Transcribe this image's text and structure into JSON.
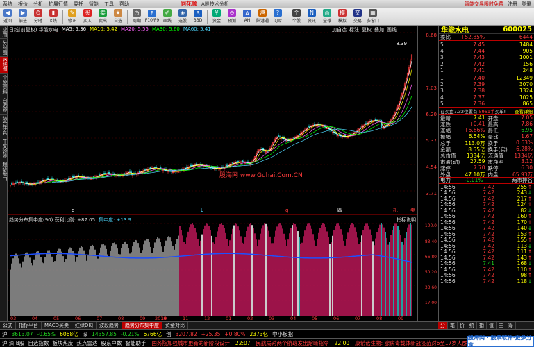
{
  "menubar": {
    "items": [
      "系统",
      "报价",
      "分析",
      "扩展行情",
      "委托",
      "智能",
      "工具",
      "帮助"
    ],
    "brand": "同花顺",
    "subtitle": "A股技术分析",
    "right": [
      "智能交易限时免费",
      "注册",
      "登录"
    ]
  },
  "toolbar": {
    "buttons": [
      {
        "label": "返回",
        "icon": "back-icon"
      },
      {
        "label": "前进",
        "icon": "forward-icon"
      },
      {
        "label": "分时",
        "icon": "timeshare-icon"
      },
      {
        "label": "K线",
        "icon": "kline-icon"
      },
      {
        "label": "修正",
        "icon": "edit-icon"
      },
      {
        "label": "买入",
        "icon": "buy-icon"
      },
      {
        "label": "卖出",
        "icon": "sell-icon"
      },
      {
        "label": "自选",
        "icon": "favorite-icon"
      },
      {
        "label": "周期",
        "icon": "period-icon"
      },
      {
        "label": "F10/F9",
        "icon": "f10-icon"
      },
      {
        "label": "画线",
        "icon": "draw-icon"
      },
      {
        "label": "选股",
        "icon": "screen-icon"
      },
      {
        "label": "BBD",
        "icon": "bbd-icon"
      },
      {
        "label": "资金",
        "icon": "fund-icon"
      },
      {
        "label": "预测",
        "icon": "forecast-icon"
      },
      {
        "label": "AH",
        "icon": "ah-icon"
      },
      {
        "label": "陆港通",
        "icon": "hk-icon"
      },
      {
        "label": "问财",
        "icon": "wencai-icon"
      },
      {
        "label": "个股",
        "icon": "stock-icon"
      },
      {
        "label": "资讯",
        "icon": "news-icon"
      },
      {
        "label": "全球",
        "icon": "global-icon"
      },
      {
        "label": "模拟",
        "icon": "sim-icon"
      },
      {
        "label": "交易",
        "icon": "trade-icon"
      },
      {
        "label": "多窗口",
        "icon": "windows-icon"
      }
    ]
  },
  "lefttabs": [
    "应用",
    "分时图",
    "K线图",
    "个股资料",
    "自选股",
    "综合排名",
    "牛叉诊股",
    "超级盘口"
  ],
  "chart": {
    "header": "日线(前复权)  华能水电",
    "ma": [
      {
        "label": "MA5: 5.36",
        "color": "#ffffff"
      },
      {
        "label": "MA10: 5.42",
        "color": "#ffff00"
      },
      {
        "label": "MA20: 5.55",
        "color": "#ff66ff"
      },
      {
        "label": "MA30: 5.60",
        "color": "#00ff00"
      },
      {
        "label": "MA60: 5.41",
        "color": "#4fd9ff"
      }
    ],
    "header_right": [
      "加自选",
      "标注",
      "复权",
      "叠加",
      "画线"
    ],
    "price_ticks": [
      "8.68",
      "7.03",
      "6.20",
      "5.37",
      "4.54",
      "3.71"
    ],
    "peak_label": "8.39",
    "indicator_header": "趋势分布集中度(90)  获利比例: +87.05",
    "indicator_sub": "集中度: +13.9",
    "indicator_right": "指标说明",
    "ind_ticks": [
      "100.0",
      "83.40",
      "66.80",
      "50.20",
      "33.60",
      "17.00"
    ],
    "dates": [
      "03",
      "04",
      "05",
      "06",
      "07",
      "08",
      "09",
      "10",
      "11",
      "12",
      "01",
      "02",
      "03",
      "04",
      "05",
      "06",
      "07",
      "08",
      "09"
    ],
    "year_label": "2019",
    "watermark_text": "股海网 www.Guhai.Com.CN",
    "markers": [
      "q",
      "L",
      "q",
      "四",
      "机",
      "卖"
    ]
  },
  "chart_data": {
    "type": "candlestick",
    "title": "华能水电 600025",
    "xlabel": "",
    "ylabel": "",
    "ylim": [
      3.71,
      8.68
    ],
    "indicator_ylim": [
      0,
      100
    ]
  },
  "right": {
    "name": "华能水电",
    "code": "600025",
    "weibi": "+52.85%",
    "weicha": "6444",
    "sell": [
      {
        "lv": "5",
        "p": "7.45",
        "v": "1484"
      },
      {
        "lv": "4",
        "p": "7.44",
        "v": "905"
      },
      {
        "lv": "3",
        "p": "7.43",
        "v": "1001"
      },
      {
        "lv": "2",
        "p": "7.42",
        "v": "156"
      },
      {
        "lv": "1",
        "p": "7.41",
        "v": "248"
      }
    ],
    "buy": [
      {
        "lv": "1",
        "p": "7.40",
        "v": "12349"
      },
      {
        "lv": "2",
        "p": "7.39",
        "v": "3070"
      },
      {
        "lv": "3",
        "p": "7.38",
        "v": "1324"
      },
      {
        "lv": "4",
        "p": "7.37",
        "v": "1025"
      },
      {
        "lv": "5",
        "p": "7.36",
        "v": "865"
      }
    ],
    "tick_head": "在买盘7.32位置有",
    "tick_head2": "5961手",
    "tick_head3": "买单!",
    "tick_head4": "查看详细",
    "stats": [
      [
        "最新",
        "7.41",
        "开盘",
        "7.05"
      ],
      [
        "涨跌",
        "+0.41",
        "最高",
        "7.86"
      ],
      [
        "涨幅",
        "+5.86%",
        "最低",
        "6.95"
      ],
      [
        "振幅",
        "6.54%",
        "量比",
        "1.67"
      ],
      [
        "总手",
        "113.0万",
        "换手",
        "0.63%"
      ],
      [
        "金额",
        "8.55亿",
        "换手(实)",
        "6.28%"
      ],
      [
        "总市值",
        "1334亿",
        "流通值",
        "1334亿"
      ],
      [
        "市盈(动)",
        "27.59",
        "市净率",
        "3.12"
      ],
      [
        "涨停",
        "7.70",
        "跌停",
        "6.30"
      ],
      [
        "外盘",
        "47.10万",
        "内盘",
        "65.93万"
      ]
    ],
    "dianli": "电力",
    "dianli_val": "-0.01%",
    "dianli_tag": "两市排名",
    "ticks": [
      [
        "14:56",
        "7.42",
        "255"
      ],
      [
        "14:56",
        "7.42",
        "243"
      ],
      [
        "14:56",
        "7.42",
        "217"
      ],
      [
        "14:56",
        "7.42",
        "124"
      ],
      [
        "14:56",
        "7.42",
        "82"
      ],
      [
        "14:56",
        "7.42",
        "160"
      ],
      [
        "14:56",
        "7.42",
        "170"
      ],
      [
        "14:56",
        "7.42",
        "140"
      ],
      [
        "14:56",
        "7.42",
        "153"
      ],
      [
        "14:56",
        "7.42",
        "155"
      ],
      [
        "14:56",
        "7.42",
        "113"
      ],
      [
        "14:56",
        "7.42",
        "111"
      ],
      [
        "14:56",
        "7.42",
        "143"
      ],
      [
        "14:56",
        "7.41",
        "168"
      ],
      [
        "14:56",
        "7.42",
        "110"
      ],
      [
        "14:56",
        "7.42",
        "98"
      ],
      [
        "14:56",
        "7.42",
        "118"
      ]
    ]
  },
  "bottom_tabs": [
    "公式",
    "指标平台",
    "MACD买卖",
    "红绿DKJ",
    "波段趋势",
    "趋势分布集中度",
    "资金对比"
  ],
  "bottom_active": "趋势分布集中度",
  "right_bottom_tabs": [
    "分",
    "笔",
    "价",
    "统",
    "指",
    "值",
    "主",
    "筹"
  ],
  "status1": {
    "sh": "沪",
    "sh_v": "3613.07",
    "sh_c": "-0.65%",
    "sh_a": "6068亿",
    "sz": "深",
    "sz_v": "14357.85",
    "sz_c": "-0.21%",
    "sz_a": "6766亿",
    "cy": "创",
    "cy_v": "3207.82",
    "cy_c": "+25.35",
    "cy_p": "+0.80%",
    "cy_a": "2373亿",
    "right": "中小板指"
  },
  "status2": {
    "items": [
      "沪 深 B股",
      "自选指数",
      "板块热度",
      "热点雷达",
      "股东户数",
      "智能助手"
    ],
    "news1": "国务院加强城市更新的新阶段设计",
    "time1": "22:07",
    "news2": "民航局对两个航班发出熔断指令",
    "time2": "22:00",
    "news3": "康希诺生物: 腺病毒载体新冠疫苗对6至17岁人群",
    "watermark": "股海网 · 股票软件·更多分享"
  }
}
